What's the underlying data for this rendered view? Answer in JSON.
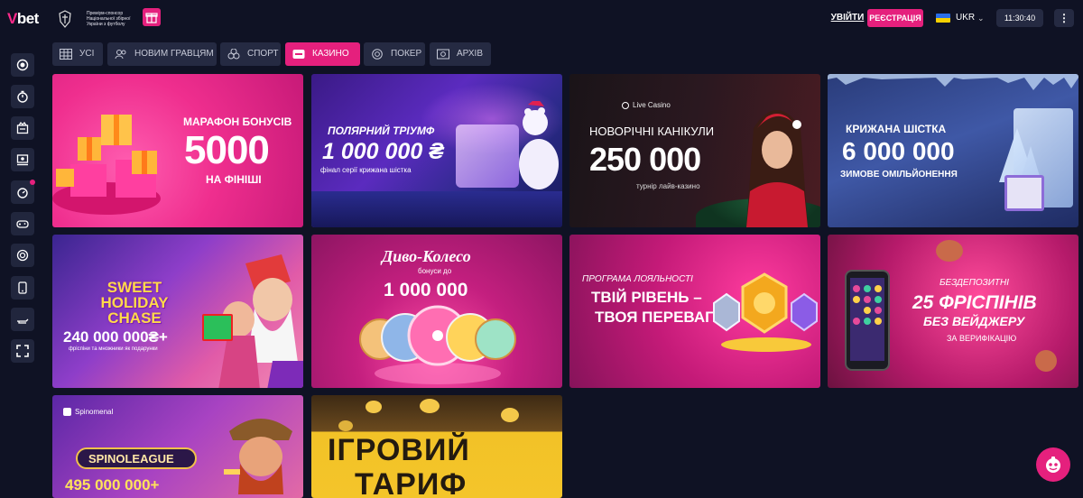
{
  "header": {
    "logo_mark": "V",
    "logo_text": "bet",
    "sponsor_text": "Преміум-спонсор Національної збірної України з футболу",
    "login_label": "УВІЙТИ",
    "register_label": "РЕЄСТРАЦІЯ",
    "language": "UKR",
    "clock": "11:30:40",
    "menu_icon": "⋮"
  },
  "sidebar": {
    "icons": [
      "live-icon",
      "stopwatch-icon",
      "casino-icon",
      "live-casino-icon",
      "sports-timer-icon",
      "gamepad-icon",
      "poker-chip-icon",
      "mobile-icon",
      "promo-icon",
      "fullscreen-icon"
    ]
  },
  "tabs": [
    {
      "label": "УСІ",
      "icon": "grid-icon"
    },
    {
      "label": "НОВИМ ГРАВЦЯМ",
      "icon": "users-icon"
    },
    {
      "label": "СПОРТ",
      "icon": "sport-icon"
    },
    {
      "label": "КАЗИНО",
      "icon": "casino-icon",
      "active": true
    },
    {
      "label": "ПОКЕР",
      "icon": "poker-icon"
    },
    {
      "label": "АРХІВ",
      "icon": "archive-icon"
    }
  ],
  "promos": {
    "marathon": {
      "title": "МАРАФОН БОНУСІВ",
      "amount": "5000",
      "sub": "НА ФІНІШІ"
    },
    "polar": {
      "title": "ПОЛЯРНИЙ ТРІУМФ",
      "amount": "1 000 000 ₴",
      "sub": "фінал серії крижана шістка"
    },
    "newyear": {
      "badge": "Live Casino",
      "title": "НОВОРІЧНІ КАНІКУЛИ",
      "amount": "250 000",
      "sub": "турнір лайв-казино"
    },
    "icy": {
      "title": "КРИЖАНА ШІСТКА",
      "amount": "6 000 000",
      "sub": "ЗИМОВЕ ОМІЛЬЙОНЕННЯ"
    },
    "sweet": {
      "game": "SWEET HOLIDAY CHASE",
      "amount": "240 000 000₴+",
      "sub": "фріспіни та множники як подарунки"
    },
    "wheel": {
      "title": "Диво-Колесо",
      "sub": "бонуси до",
      "amount": "1 000 000"
    },
    "loyalty": {
      "title": "ПРОГРАМА ЛОЯЛЬНОСТІ",
      "line1": "ТВІЙ РІВЕНЬ –",
      "line2": "ТВОЯ ПЕРЕВАГА"
    },
    "freespins": {
      "title": "БЕЗДЕПОЗИТНІ",
      "amount": "25 ФРІСПІНІВ",
      "line2": "БЕЗ ВЕЙДЖЕРУ",
      "sub": "ЗА ВЕРИФІКАЦІЮ"
    },
    "spino": {
      "brand": "Spinomenal",
      "title": "SPINOLEAGUE",
      "amount": "495 000 000+"
    },
    "tariff": {
      "line1": "ІГРОВИЙ",
      "line2": "ТАРИФ"
    }
  },
  "colors": {
    "accent": "#e5207d",
    "background": "#0f1224",
    "panel": "#252a42"
  }
}
